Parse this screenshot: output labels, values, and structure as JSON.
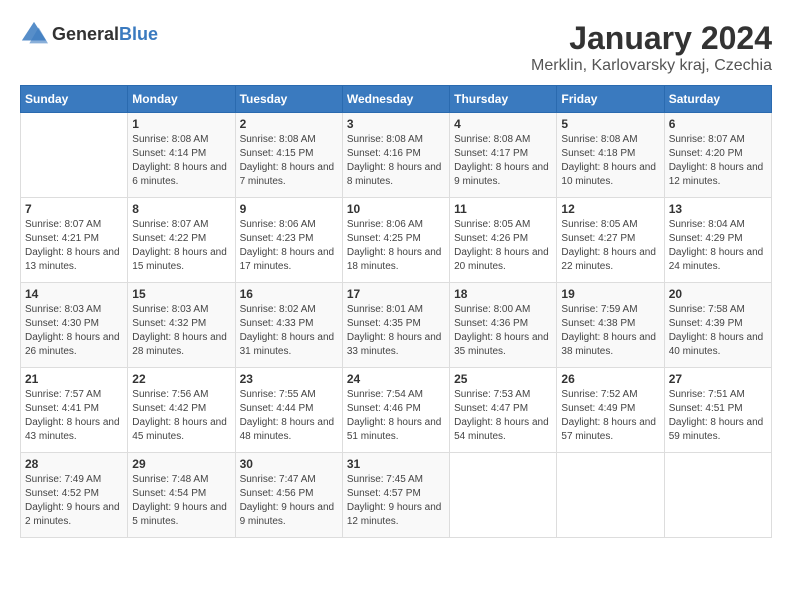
{
  "logo": {
    "general": "General",
    "blue": "Blue"
  },
  "header": {
    "month": "January 2024",
    "location": "Merklin, Karlovarsky kraj, Czechia"
  },
  "weekdays": [
    "Sunday",
    "Monday",
    "Tuesday",
    "Wednesday",
    "Thursday",
    "Friday",
    "Saturday"
  ],
  "weeks": [
    [
      {
        "day": "",
        "sunrise": "",
        "sunset": "",
        "daylight": ""
      },
      {
        "day": "1",
        "sunrise": "Sunrise: 8:08 AM",
        "sunset": "Sunset: 4:14 PM",
        "daylight": "Daylight: 8 hours and 6 minutes."
      },
      {
        "day": "2",
        "sunrise": "Sunrise: 8:08 AM",
        "sunset": "Sunset: 4:15 PM",
        "daylight": "Daylight: 8 hours and 7 minutes."
      },
      {
        "day": "3",
        "sunrise": "Sunrise: 8:08 AM",
        "sunset": "Sunset: 4:16 PM",
        "daylight": "Daylight: 8 hours and 8 minutes."
      },
      {
        "day": "4",
        "sunrise": "Sunrise: 8:08 AM",
        "sunset": "Sunset: 4:17 PM",
        "daylight": "Daylight: 8 hours and 9 minutes."
      },
      {
        "day": "5",
        "sunrise": "Sunrise: 8:08 AM",
        "sunset": "Sunset: 4:18 PM",
        "daylight": "Daylight: 8 hours and 10 minutes."
      },
      {
        "day": "6",
        "sunrise": "Sunrise: 8:07 AM",
        "sunset": "Sunset: 4:20 PM",
        "daylight": "Daylight: 8 hours and 12 minutes."
      }
    ],
    [
      {
        "day": "7",
        "sunrise": "Sunrise: 8:07 AM",
        "sunset": "Sunset: 4:21 PM",
        "daylight": "Daylight: 8 hours and 13 minutes."
      },
      {
        "day": "8",
        "sunrise": "Sunrise: 8:07 AM",
        "sunset": "Sunset: 4:22 PM",
        "daylight": "Daylight: 8 hours and 15 minutes."
      },
      {
        "day": "9",
        "sunrise": "Sunrise: 8:06 AM",
        "sunset": "Sunset: 4:23 PM",
        "daylight": "Daylight: 8 hours and 17 minutes."
      },
      {
        "day": "10",
        "sunrise": "Sunrise: 8:06 AM",
        "sunset": "Sunset: 4:25 PM",
        "daylight": "Daylight: 8 hours and 18 minutes."
      },
      {
        "day": "11",
        "sunrise": "Sunrise: 8:05 AM",
        "sunset": "Sunset: 4:26 PM",
        "daylight": "Daylight: 8 hours and 20 minutes."
      },
      {
        "day": "12",
        "sunrise": "Sunrise: 8:05 AM",
        "sunset": "Sunset: 4:27 PM",
        "daylight": "Daylight: 8 hours and 22 minutes."
      },
      {
        "day": "13",
        "sunrise": "Sunrise: 8:04 AM",
        "sunset": "Sunset: 4:29 PM",
        "daylight": "Daylight: 8 hours and 24 minutes."
      }
    ],
    [
      {
        "day": "14",
        "sunrise": "Sunrise: 8:03 AM",
        "sunset": "Sunset: 4:30 PM",
        "daylight": "Daylight: 8 hours and 26 minutes."
      },
      {
        "day": "15",
        "sunrise": "Sunrise: 8:03 AM",
        "sunset": "Sunset: 4:32 PM",
        "daylight": "Daylight: 8 hours and 28 minutes."
      },
      {
        "day": "16",
        "sunrise": "Sunrise: 8:02 AM",
        "sunset": "Sunset: 4:33 PM",
        "daylight": "Daylight: 8 hours and 31 minutes."
      },
      {
        "day": "17",
        "sunrise": "Sunrise: 8:01 AM",
        "sunset": "Sunset: 4:35 PM",
        "daylight": "Daylight: 8 hours and 33 minutes."
      },
      {
        "day": "18",
        "sunrise": "Sunrise: 8:00 AM",
        "sunset": "Sunset: 4:36 PM",
        "daylight": "Daylight: 8 hours and 35 minutes."
      },
      {
        "day": "19",
        "sunrise": "Sunrise: 7:59 AM",
        "sunset": "Sunset: 4:38 PM",
        "daylight": "Daylight: 8 hours and 38 minutes."
      },
      {
        "day": "20",
        "sunrise": "Sunrise: 7:58 AM",
        "sunset": "Sunset: 4:39 PM",
        "daylight": "Daylight: 8 hours and 40 minutes."
      }
    ],
    [
      {
        "day": "21",
        "sunrise": "Sunrise: 7:57 AM",
        "sunset": "Sunset: 4:41 PM",
        "daylight": "Daylight: 8 hours and 43 minutes."
      },
      {
        "day": "22",
        "sunrise": "Sunrise: 7:56 AM",
        "sunset": "Sunset: 4:42 PM",
        "daylight": "Daylight: 8 hours and 45 minutes."
      },
      {
        "day": "23",
        "sunrise": "Sunrise: 7:55 AM",
        "sunset": "Sunset: 4:44 PM",
        "daylight": "Daylight: 8 hours and 48 minutes."
      },
      {
        "day": "24",
        "sunrise": "Sunrise: 7:54 AM",
        "sunset": "Sunset: 4:46 PM",
        "daylight": "Daylight: 8 hours and 51 minutes."
      },
      {
        "day": "25",
        "sunrise": "Sunrise: 7:53 AM",
        "sunset": "Sunset: 4:47 PM",
        "daylight": "Daylight: 8 hours and 54 minutes."
      },
      {
        "day": "26",
        "sunrise": "Sunrise: 7:52 AM",
        "sunset": "Sunset: 4:49 PM",
        "daylight": "Daylight: 8 hours and 57 minutes."
      },
      {
        "day": "27",
        "sunrise": "Sunrise: 7:51 AM",
        "sunset": "Sunset: 4:51 PM",
        "daylight": "Daylight: 8 hours and 59 minutes."
      }
    ],
    [
      {
        "day": "28",
        "sunrise": "Sunrise: 7:49 AM",
        "sunset": "Sunset: 4:52 PM",
        "daylight": "Daylight: 9 hours and 2 minutes."
      },
      {
        "day": "29",
        "sunrise": "Sunrise: 7:48 AM",
        "sunset": "Sunset: 4:54 PM",
        "daylight": "Daylight: 9 hours and 5 minutes."
      },
      {
        "day": "30",
        "sunrise": "Sunrise: 7:47 AM",
        "sunset": "Sunset: 4:56 PM",
        "daylight": "Daylight: 9 hours and 9 minutes."
      },
      {
        "day": "31",
        "sunrise": "Sunrise: 7:45 AM",
        "sunset": "Sunset: 4:57 PM",
        "daylight": "Daylight: 9 hours and 12 minutes."
      },
      {
        "day": "",
        "sunrise": "",
        "sunset": "",
        "daylight": ""
      },
      {
        "day": "",
        "sunrise": "",
        "sunset": "",
        "daylight": ""
      },
      {
        "day": "",
        "sunrise": "",
        "sunset": "",
        "daylight": ""
      }
    ]
  ]
}
